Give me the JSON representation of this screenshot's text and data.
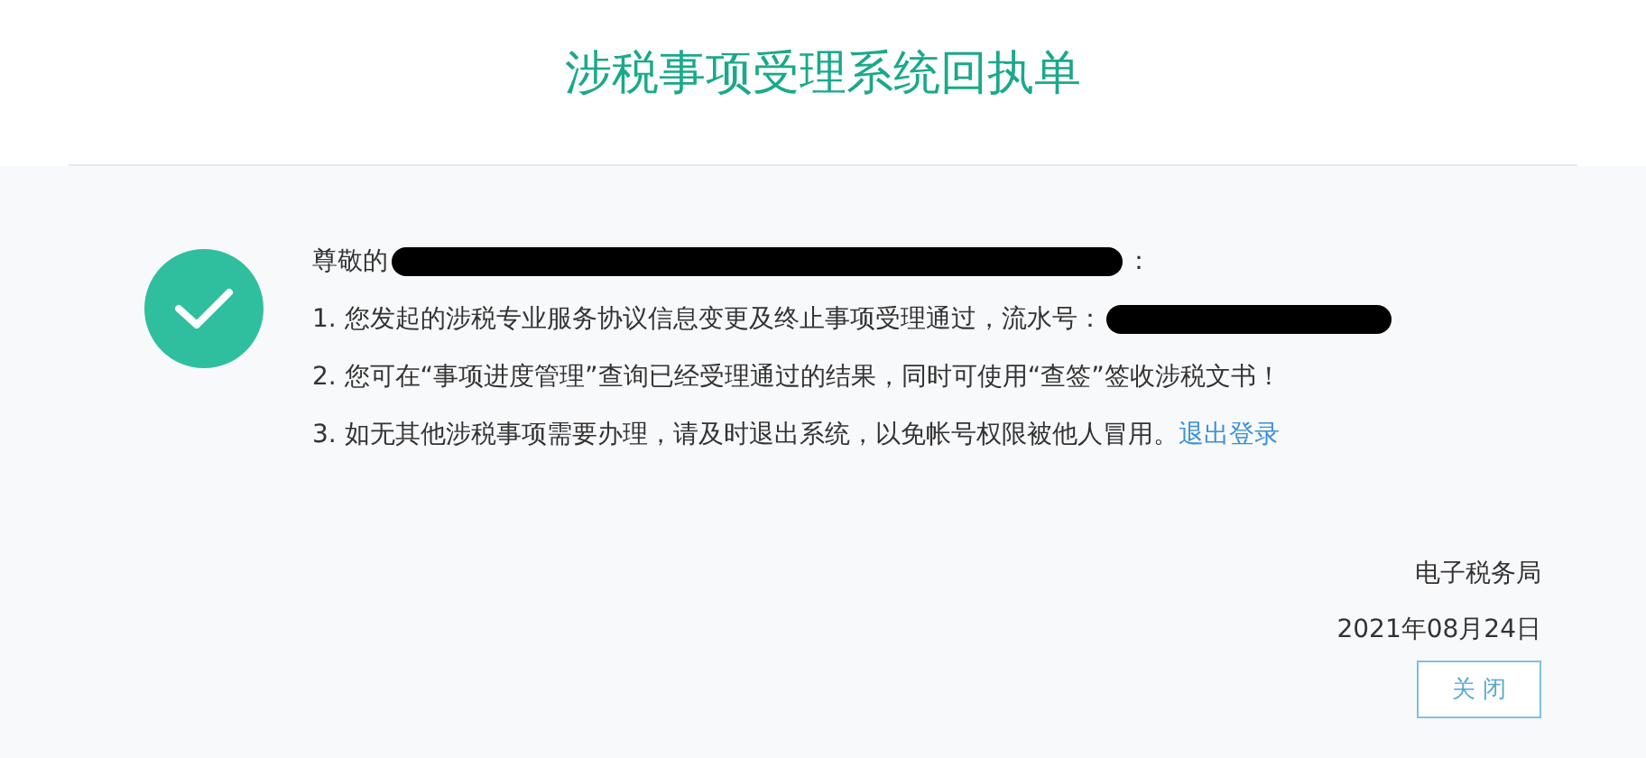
{
  "title": "涉税事项受理系统回执单",
  "greeting": {
    "text": "尊敬的",
    "redacted": true,
    "suffix": "："
  },
  "lines": [
    {
      "text": "1. 您发起的涉税专业服务协议信息变更及终止事项受理通过，流水号：",
      "redacted": true
    },
    {
      "text": "2. 您可在“事项进度管理”查询已经受理通过的结果，同时可使用“查签”签收涉税文书！",
      "redacted": false
    },
    {
      "text": "3. 如无其他涉税事项需要办理，请及时退出系统，以免帐号权限被他人冒用。",
      "redacted": false,
      "link": "退出登录"
    }
  ],
  "issuer": "电子税务局",
  "date": "2021年08月24日",
  "close_button": "关 闭"
}
